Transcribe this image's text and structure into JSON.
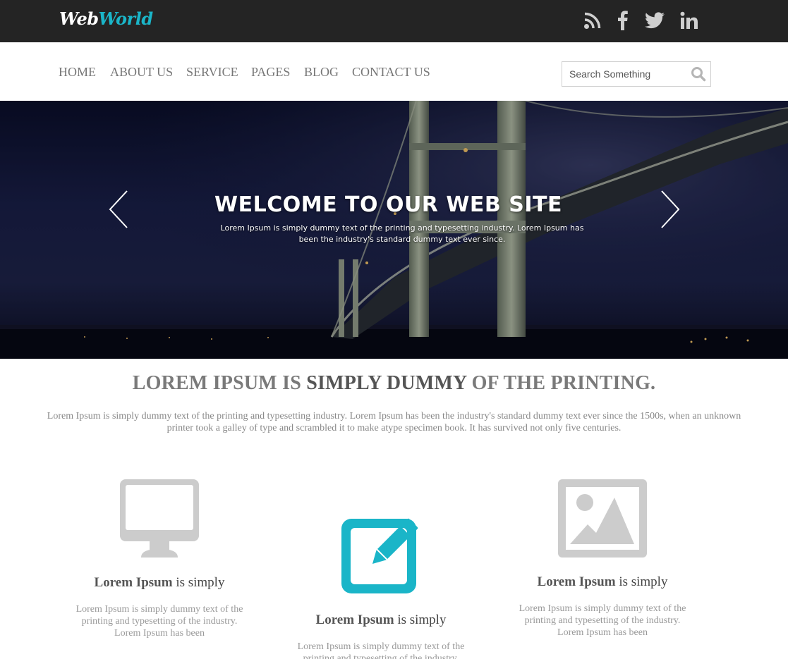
{
  "brand": {
    "part1": "Web",
    "part2": "World"
  },
  "social": [
    {
      "name": "rss",
      "icon": "rss-icon"
    },
    {
      "name": "facebook",
      "icon": "facebook-icon"
    },
    {
      "name": "twitter",
      "icon": "twitter-icon"
    },
    {
      "name": "linkedin",
      "icon": "linkedin-icon"
    }
  ],
  "nav": {
    "items": [
      "HOME",
      "ABOUT US",
      "SERVICE",
      "PAGES",
      "BLOG",
      "CONTACT US"
    ],
    "search_placeholder": "Search Something"
  },
  "hero": {
    "title": "WELCOME TO OUR WEB SITE",
    "text": "Lorem Ipsum is simply dummy text of the printing and typesetting industry. Lorem Ipsum has been the industry's standard dummy text ever since."
  },
  "intro": {
    "title_part1": "LOREM IPSUM IS ",
    "title_part2": "SIMPLY DUMMY",
    "title_part3": " OF THE PRINTING.",
    "text": "Lorem Ipsum is simply dummy text of the printing and typesetting industry. Lorem Ipsum has been the industry's standard dummy text ever since the 1500s, when an unknown printer took a galley of type and scrambled it to make atype specimen book. It has survived not only five centuries."
  },
  "features": [
    {
      "icon": "monitor-icon",
      "title_bold": "Lorem Ipsum",
      "title_rest": " is simply",
      "text": "Lorem Ipsum is simply dummy text of the printing and typesetting of the industry. Lorem Ipsum has been"
    },
    {
      "icon": "edit-icon",
      "title_bold": "Lorem Ipsum",
      "title_rest": " is simply",
      "text": "Lorem Ipsum is simply dummy text of the printing and typesetting of the industry. Lorem Ipsum has been"
    },
    {
      "icon": "image-icon",
      "title_bold": "Lorem Ipsum",
      "title_rest": " is simply",
      "text": "Lorem Ipsum is simply dummy text of the printing and typesetting of the industry. Lorem Ipsum has been"
    }
  ],
  "colors": {
    "accent": "#1ab5c8",
    "topbar": "#242424",
    "icon_gray": "#cccccc"
  }
}
